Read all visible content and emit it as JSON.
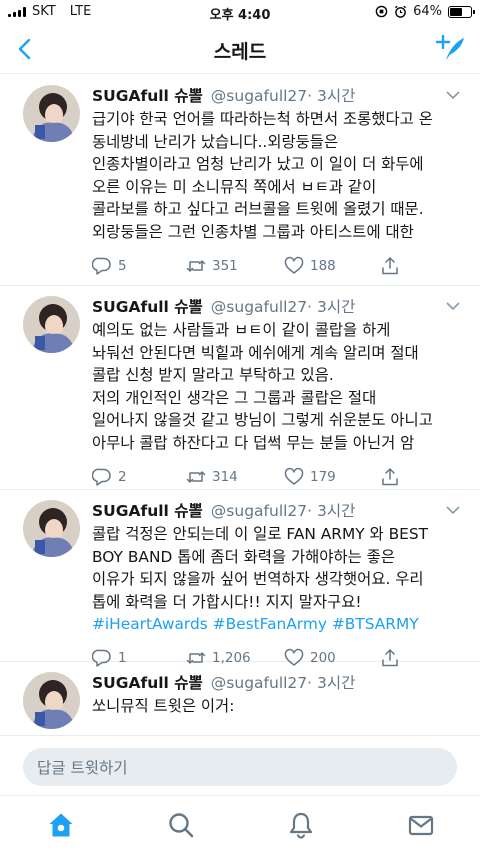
{
  "status_bar": {
    "carrier": "SKT",
    "network": "LTE",
    "time": "오후 4:40",
    "battery": "64%",
    "battery_level": 0.64
  },
  "header": {
    "title": "스레드",
    "back_icon": "chevron-left-icon",
    "compose_icon": "compose-tweet-icon"
  },
  "colors": {
    "accent": "#1da1f2",
    "secondary_text": "#657786",
    "divider": "#e6ecf0",
    "text": "#14171a"
  },
  "tweets": [
    {
      "name": "SUGAfull 슈뽈",
      "handle": "@sugafull27",
      "time": "· 3시간",
      "lines": [
        "급기야 한국 언어를 따라하는척 하면서 조롱했다고 온",
        "동네방네 난리가 났습니다..외랑둥들은",
        "인종차별이라고 엄청 난리가 났고 이 일이 더 화두에",
        "오른 이유는 미 소니뮤직 쪽에서 ㅂㅌ과 같이",
        "콜라보를 하고 싶다고 러브콜을 트윗에 올렸기 때문.",
        "외랑둥들은 그런 인종차별 그룹과 아티스트에 대한"
      ],
      "replies": "5",
      "retweets": "351",
      "likes": "188"
    },
    {
      "name": "SUGAfull 슈뽈",
      "handle": "@sugafull27",
      "time": "· 3시간",
      "lines": [
        "예의도 없는 사람들과 ㅂㅌ이 같이 콜랍을 하게",
        "놔둬선 안된다면 빅힡과 에쉬에게 계속 알리며 절대",
        "콜랍 신청 받지 말라고 부탁하고 있음.",
        "저의 개인적인 생각은 그 그룹과 콜랍은 절대",
        "일어나지 않을것 같고 방님이 그렇게 쉬운분도 아니고",
        "아무나 콜랍 하잔다고 다 덥썩 무는 분들 아닌거 암"
      ],
      "replies": "2",
      "retweets": "314",
      "likes": "179"
    },
    {
      "name": "SUGAfull 슈뽈",
      "handle": "@sugafull27",
      "time": "· 3시간",
      "lines": [
        "콜랍 걱정은 안되는데 이 일로 FAN ARMY 와 BEST",
        "BOY BAND 톱에 좀더 화력을 가해야하는 좋은",
        "이유가 되지 않을까 싶어 번역하자 생각햇어요. 우리",
        "톱에 화력을 더 가합시다!! 지지 말자구요!"
      ],
      "hashtags_line": "#iHeartAwards #BestFanArmy #BTSARMY",
      "replies": "1",
      "retweets": "1,206",
      "likes": "200"
    },
    {
      "name": "SUGAfull 슈뽈",
      "handle": "@sugafull27",
      "time": "· 3시간",
      "lines": [
        "쏘니뮤직 트윗은 이거:"
      ]
    }
  ],
  "reply_bar": {
    "placeholder": "답글 트윗하기"
  },
  "tab_bar": {
    "items": [
      "home-icon",
      "search-icon",
      "notifications-icon",
      "messages-icon"
    ]
  }
}
